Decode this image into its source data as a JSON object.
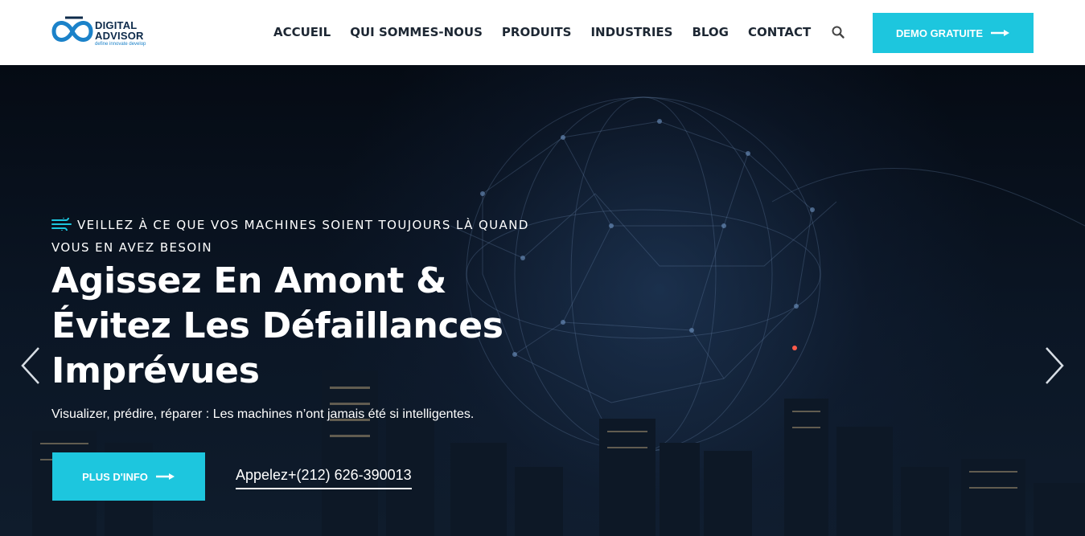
{
  "brand": {
    "name_line1": "DIGITAL",
    "name_line2": "ADVISOR",
    "tagline": "define innovate develop",
    "colors": {
      "accent": "#1dc6de",
      "dark": "#0d2a4a",
      "logo_blue": "#1b82c9"
    }
  },
  "nav": {
    "items": [
      "ACCUEIL",
      "QUI SOMMES-NOUS",
      "PRODUITS",
      "INDUSTRIES",
      "BLOG",
      "CONTACT"
    ],
    "search_icon": "search-icon",
    "demo_button": "DEMO GRATUITE"
  },
  "hero": {
    "eyebrow": "VEILLEZ À CE QUE VOS MACHINES SOIENT TOUJOURS LÀ QUAND VOUS EN AVEZ BESOIN",
    "headline": "Agissez En Amont & Évitez Les Défaillances Imprévues",
    "subtitle": "Visualizer, prédire, réparer : Les machines n’ont jamais été si intelligentes.",
    "cta_button": "PLUS D'INFO",
    "call_link": "Appelez+(212) 626-390013",
    "prev_icon": "chevron-left-icon",
    "next_icon": "chevron-right-icon"
  }
}
